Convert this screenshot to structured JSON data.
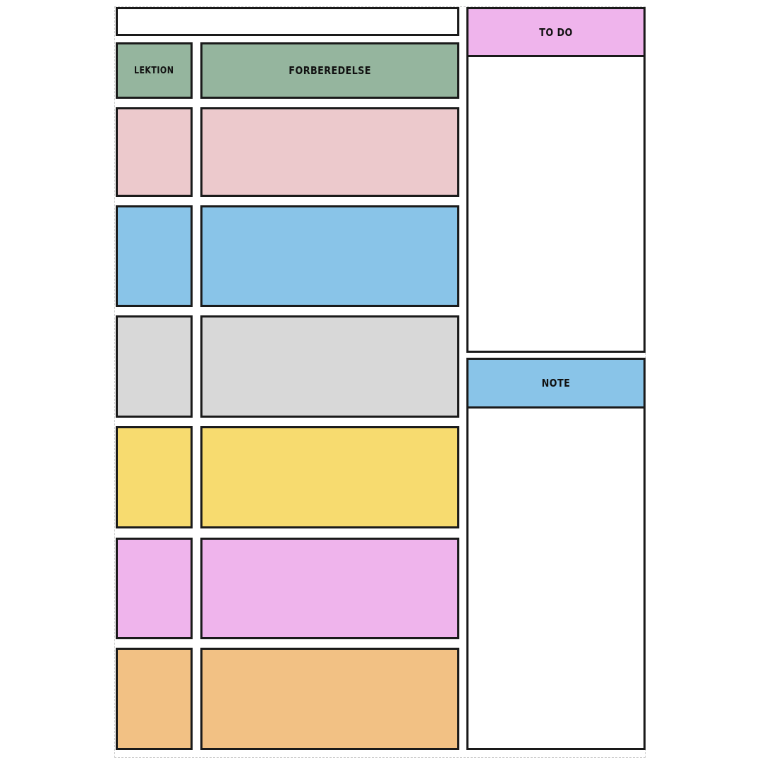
{
  "header": {
    "title_value": ""
  },
  "table": {
    "columns": [
      {
        "label": "LEKTION"
      },
      {
        "label": "FORBEREDELSE"
      }
    ],
    "header_color": "#95b59e",
    "rows": [
      {
        "color": "#ecc9cc",
        "lektion": "",
        "forberedelse": ""
      },
      {
        "color": "#89c4e8",
        "lektion": "",
        "forberedelse": ""
      },
      {
        "color": "#d8d8d8",
        "lektion": "",
        "forberedelse": ""
      },
      {
        "color": "#f7db6f",
        "lektion": "",
        "forberedelse": ""
      },
      {
        "color": "#efb4ec",
        "lektion": "",
        "forberedelse": ""
      },
      {
        "color": "#f2c184",
        "lektion": "",
        "forberedelse": ""
      }
    ]
  },
  "todo": {
    "label": "TO DO",
    "color": "#efb4ec",
    "content": ""
  },
  "note": {
    "label": "NOTE",
    "color": "#89c4e8",
    "content": ""
  }
}
